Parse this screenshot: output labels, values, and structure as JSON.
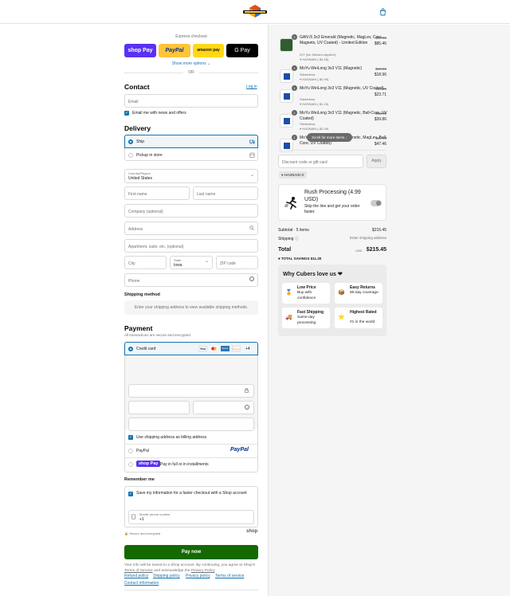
{
  "header": {
    "logo_alt": "SpeedCubeShop logo",
    "cart_icon": "shopping-bag-icon"
  },
  "express": {
    "title": "Express checkout",
    "shop_pay": "shop Pay",
    "paypal": "PayPal",
    "amazon_pay": "amazon pay",
    "gpay": "G Pay",
    "show_more": "Show more options",
    "or": "OR"
  },
  "contact": {
    "heading": "Contact",
    "login": "Log in",
    "email_placeholder": "Email",
    "email_news": "Email me with news and offers"
  },
  "delivery": {
    "heading": "Delivery",
    "ship": "Ship",
    "pickup": "Pickup in store",
    "country_label": "Country/Region",
    "country_value": "United States",
    "first_name": "First name",
    "last_name": "Last name",
    "company": "Company (optional)",
    "address": "Address",
    "apartment": "Apartment, suite, etc. (optional)",
    "city": "City",
    "state_label": "State",
    "state_value": "Iowa",
    "zip": "ZIP code",
    "phone": "Phone"
  },
  "shipping_method": {
    "heading": "Shipping method",
    "placeholder": "Enter your shipping address to view available shipping methods."
  },
  "payment": {
    "heading": "Payment",
    "subtitle": "All transactions are secure and encrypted.",
    "credit_card": "Credit card",
    "card_more": "+4",
    "card_brands": [
      "Visa",
      "Mastercard",
      "Amex",
      "Discover"
    ],
    "billing_same": "Use shipping address as billing address",
    "paypal": "PayPal",
    "paypal_logo": "PayPal",
    "shop_pay_logo": "shop Pay",
    "shop_pay_text": "Pay in full or in installments"
  },
  "remember": {
    "heading": "Remember me",
    "save_info": "Save my information for a faster checkout with a Shop account",
    "mobile_label": "Mobile phone number",
    "mobile_value": "+1",
    "secure": "Secure and encrypted",
    "shop_logo": "shop"
  },
  "pay_now": "Pay now",
  "disclaimer": {
    "text1": "Your info will be saved to a Shop account. By continuing, you agree to Shop's",
    "terms": "Terms of Service",
    "text2": "and acknowledge the",
    "privacy": "Privacy Policy",
    "end": "."
  },
  "footer": {
    "links": [
      "Refund policy",
      "Shipping policy",
      "Privacy policy",
      "Terms of service",
      "Contact information"
    ]
  },
  "cart": {
    "items": [
      {
        "qty": "1",
        "title": "GAN i5 3x3 Emerald (Magnetic, MagLev, Core Magnets, UV Coated) - Limited Edition",
        "variant": "DIY (No Stickers Applied)",
        "discount": "HASNAIN (-$4.45)",
        "orig": "$89.95",
        "price": "$85.46"
      },
      {
        "qty": "1",
        "title": "MoYu WeiLong 3x3 V11 (Magnetic)",
        "variant": "Stickerless",
        "discount": "HASNAIN (-$0.99)",
        "orig": "$19.95",
        "price": "$18.96"
      },
      {
        "qty": "1",
        "title": "MoYu WeiLong 3x3 V11 (Magnetic, UV Coated)",
        "variant": "Stickerless",
        "discount": "HASNAIN (-$1.24)",
        "orig": "$24.95",
        "price": "$23.71"
      },
      {
        "qty": "1",
        "title": "MoYu WeiLong 3x3 V11 (Magnetic, Ball-Core, UV Coated)",
        "variant": "Stickerless",
        "discount": "HASNAIN (-$2.09)",
        "orig": "$41.95",
        "price": "$39.86"
      },
      {
        "qty": "1",
        "title": "MoYu WeiLong 3x3 V11 (Magnetic, MagLev, Ball-Core, UV Coated)",
        "variant": "Stickerless",
        "discount": "HASNAIN (-$2.49)",
        "orig": "$49.95",
        "price": "$47.46"
      }
    ],
    "scroll_hint": "Scroll for more items",
    "discount_placeholder": "Discount code or gift card",
    "apply": "Apply",
    "applied_code": "HASNAIN",
    "rush": {
      "title": "Rush Processing (4.99 USD)",
      "desc": "Skip the line and get your order faster."
    },
    "subtotal_label": "Subtotal · 5 items",
    "subtotal_value": "$215.45",
    "shipping_label": "Shipping",
    "shipping_value": "Enter shipping address",
    "total_label": "Total",
    "currency": "USD",
    "total_value": "$215.45",
    "savings_label": "TOTAL SAVINGS",
    "savings_value": "$11.30",
    "love_heading": "Why Cubers love us ❤",
    "benefits": [
      {
        "icon": "🏅",
        "title": "Low Price",
        "desc": "Buy with confidence"
      },
      {
        "icon": "📦",
        "title": "Easy Returns",
        "desc": "90-day coverage"
      },
      {
        "icon": "🚚",
        "title": "Fast Shipping",
        "desc": "Same-day processing"
      },
      {
        "icon": "⭐",
        "title": "Highest Rated",
        "desc": "#1 in the world"
      }
    ]
  }
}
